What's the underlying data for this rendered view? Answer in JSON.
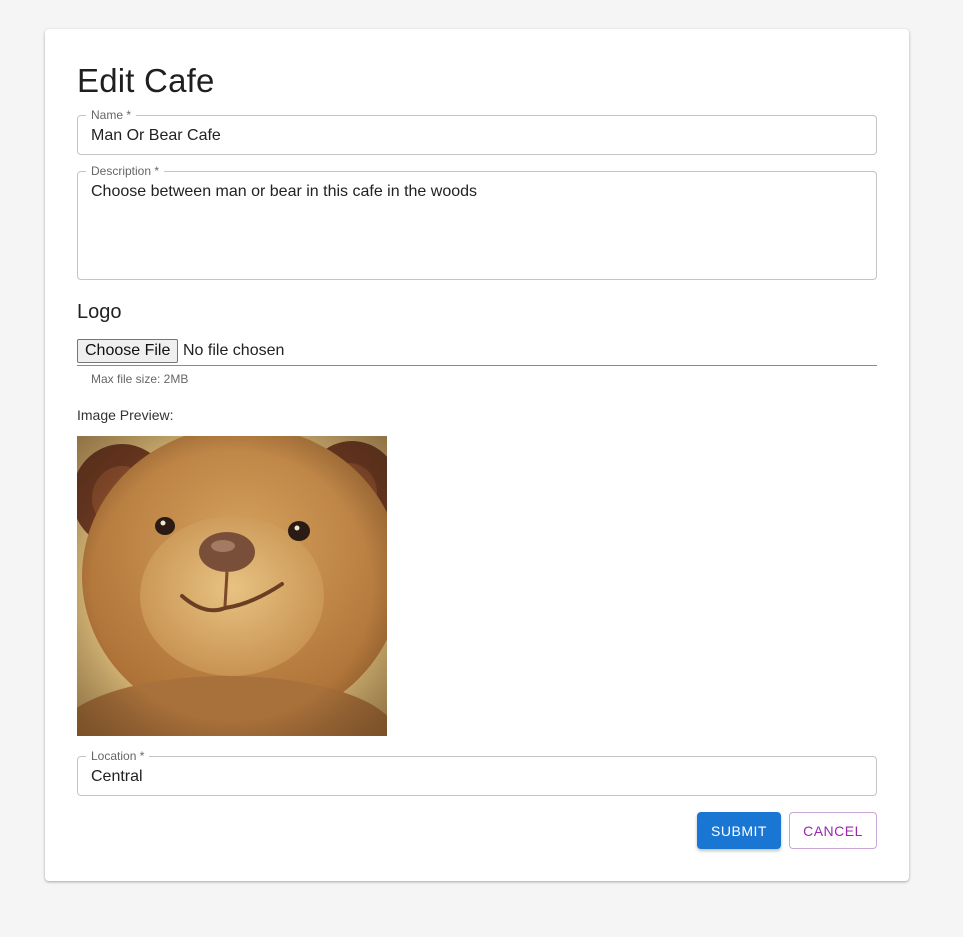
{
  "form": {
    "title": "Edit Cafe",
    "name": {
      "label": "Name *",
      "value": "Man Or Bear Cafe"
    },
    "description": {
      "label": "Description *",
      "value": "Choose between man or bear in this cafe in the woods"
    },
    "logo": {
      "heading": "Logo",
      "choose_file_label": "Choose File",
      "file_status": "No file chosen",
      "helper": "Max file size: 2MB",
      "preview_label": "Image Preview:"
    },
    "location": {
      "label": "Location *",
      "value": "Central"
    },
    "actions": {
      "submit_label": "SUBMIT",
      "cancel_label": "CANCEL"
    }
  },
  "colors": {
    "primary": "#1976d2",
    "secondary": "#9c27b0",
    "background": "#f5f5f5",
    "surface": "#ffffff"
  }
}
